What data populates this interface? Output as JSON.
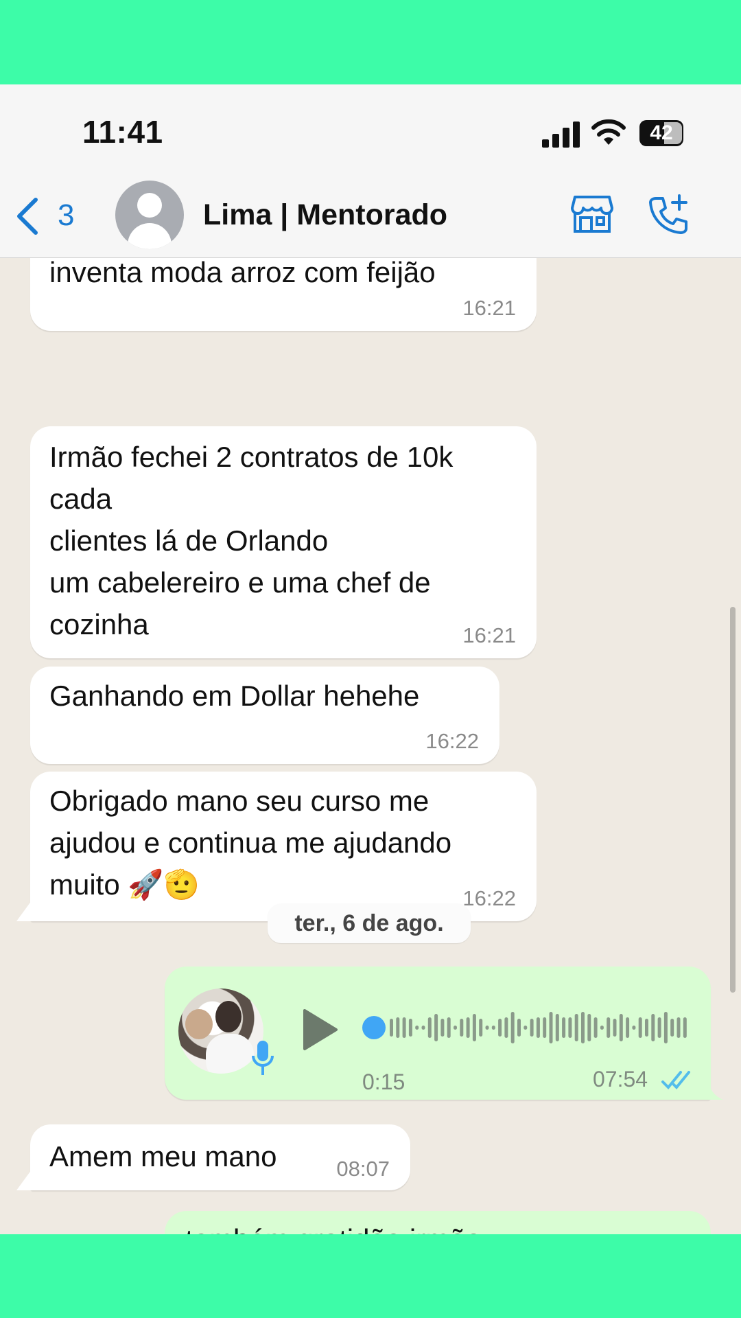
{
  "status_bar": {
    "time": "11:41",
    "battery": "42"
  },
  "header": {
    "back_count": "3",
    "contact_name": "Lima | Mentorado"
  },
  "messages": [
    {
      "text": "inventa moda arroz com feijão",
      "time": "16:21",
      "direction": "in"
    },
    {
      "text": "Irmão fechei 2 contratos de 10k\ncada\nclientes lá de Orlando\num cabelereiro e uma chef de\ncozinha",
      "time": "16:21",
      "direction": "in"
    },
    {
      "text": "Ganhando em Dollar hehehe",
      "time": "16:22",
      "direction": "in"
    },
    {
      "text": "Obrigado mano seu curso me\najudou e continua me ajudando\nmuito 🚀🫡",
      "time": "16:22",
      "direction": "in"
    }
  ],
  "date_separator": "ter., 6 de ago.",
  "voice_message": {
    "duration": "0:15",
    "time": "07:54",
    "status": "read",
    "direction": "out"
  },
  "reply_message": {
    "text": "Amem meu mano",
    "time": "08:07",
    "direction": "in"
  },
  "partial_message": {
    "text": "também gratidão irmão",
    "direction": "out"
  },
  "colors": {
    "frame_background": "#3dfca8",
    "chat_background": "#efeae2",
    "incoming_bubble": "#ffffff",
    "outgoing_bubble": "#d9fdd3",
    "accent_blue": "#1a7ad1",
    "read_tick": "#53bdeb"
  },
  "icons": {
    "back": "chevron-left-icon",
    "store": "storefront-icon",
    "call": "phone-plus-icon",
    "mic": "mic-icon",
    "play": "play-icon"
  }
}
